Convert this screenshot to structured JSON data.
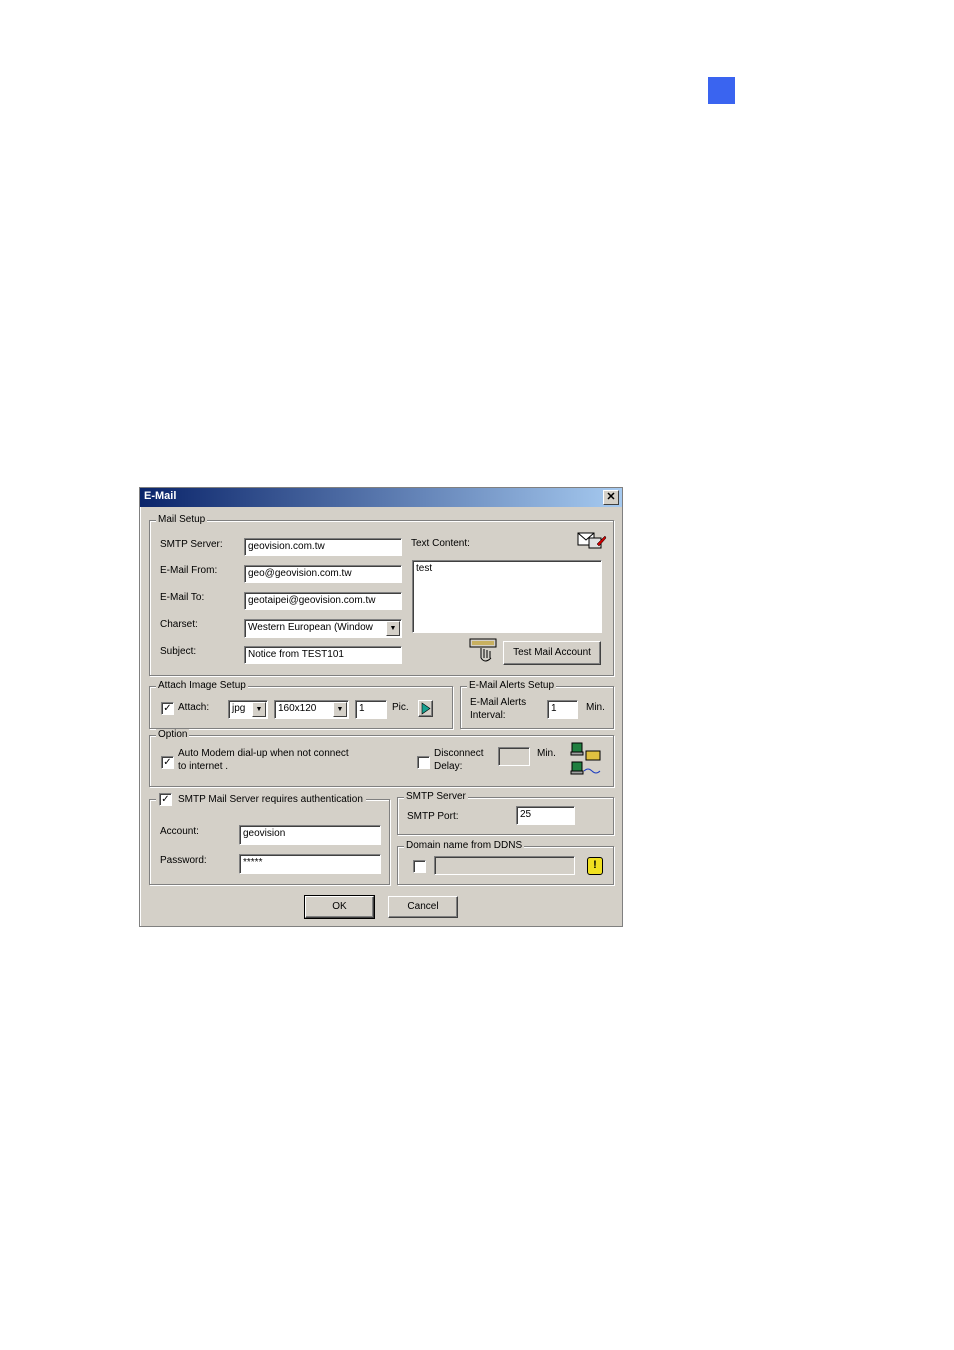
{
  "dialog": {
    "title": "E-Mail",
    "close_glyph": "✕"
  },
  "mail_setup": {
    "legend": "Mail Setup",
    "smtp_server_label": "SMTP Server:",
    "smtp_server_value": "geovision.com.tw",
    "from_label": "E-Mail From:",
    "from_value": "geo@geovision.com.tw",
    "to_label": "E-Mail To:",
    "to_value": "geotaipei@geovision.com.tw",
    "charset_label": "Charset:",
    "charset_value": "Western European (Window",
    "subject_label": "Subject:",
    "subject_value": "Notice from TEST101",
    "text_content_label": "Text Content:",
    "text_content_value": "test",
    "test_button": "Test Mail Account"
  },
  "attach_image": {
    "legend": "Attach Image Setup",
    "attach_label": "Attach:",
    "attach_checked": "✓",
    "format_value": "jpg",
    "size_value": "160x120",
    "pic_count": "1",
    "pic_label": "Pic."
  },
  "alerts": {
    "legend": "E-Mail Alerts Setup",
    "interval_label_1": "E-Mail Alerts",
    "interval_label_2": "Interval:",
    "interval_value": "1",
    "unit": "Min."
  },
  "option": {
    "legend": "Option",
    "auto_modem_checked": "✓",
    "auto_modem_line1": "Auto Modem dial-up when not connect",
    "auto_modem_line2": "to internet .",
    "disconnect_line1": "Disconnect",
    "disconnect_line2": "Delay:",
    "delay_unit": "Min."
  },
  "auth": {
    "checkbox_checked": "✓",
    "label": "SMTP Mail Server requires authentication",
    "account_label": "Account:",
    "account_value": "geovision",
    "password_label": "Password:",
    "password_value": "*****"
  },
  "smtp_server": {
    "legend": "SMTP Server",
    "port_label": "SMTP Port:",
    "port_value": "25"
  },
  "ddns": {
    "legend": "Domain name from DDNS",
    "warn_glyph": "!"
  },
  "buttons": {
    "ok": "OK",
    "cancel": "Cancel"
  },
  "colors": {
    "page_marker": "#3a64f0",
    "titlebar_start": "#0a246a",
    "titlebar_end": "#a6caf0",
    "dialog_bg": "#d4d0c8"
  }
}
